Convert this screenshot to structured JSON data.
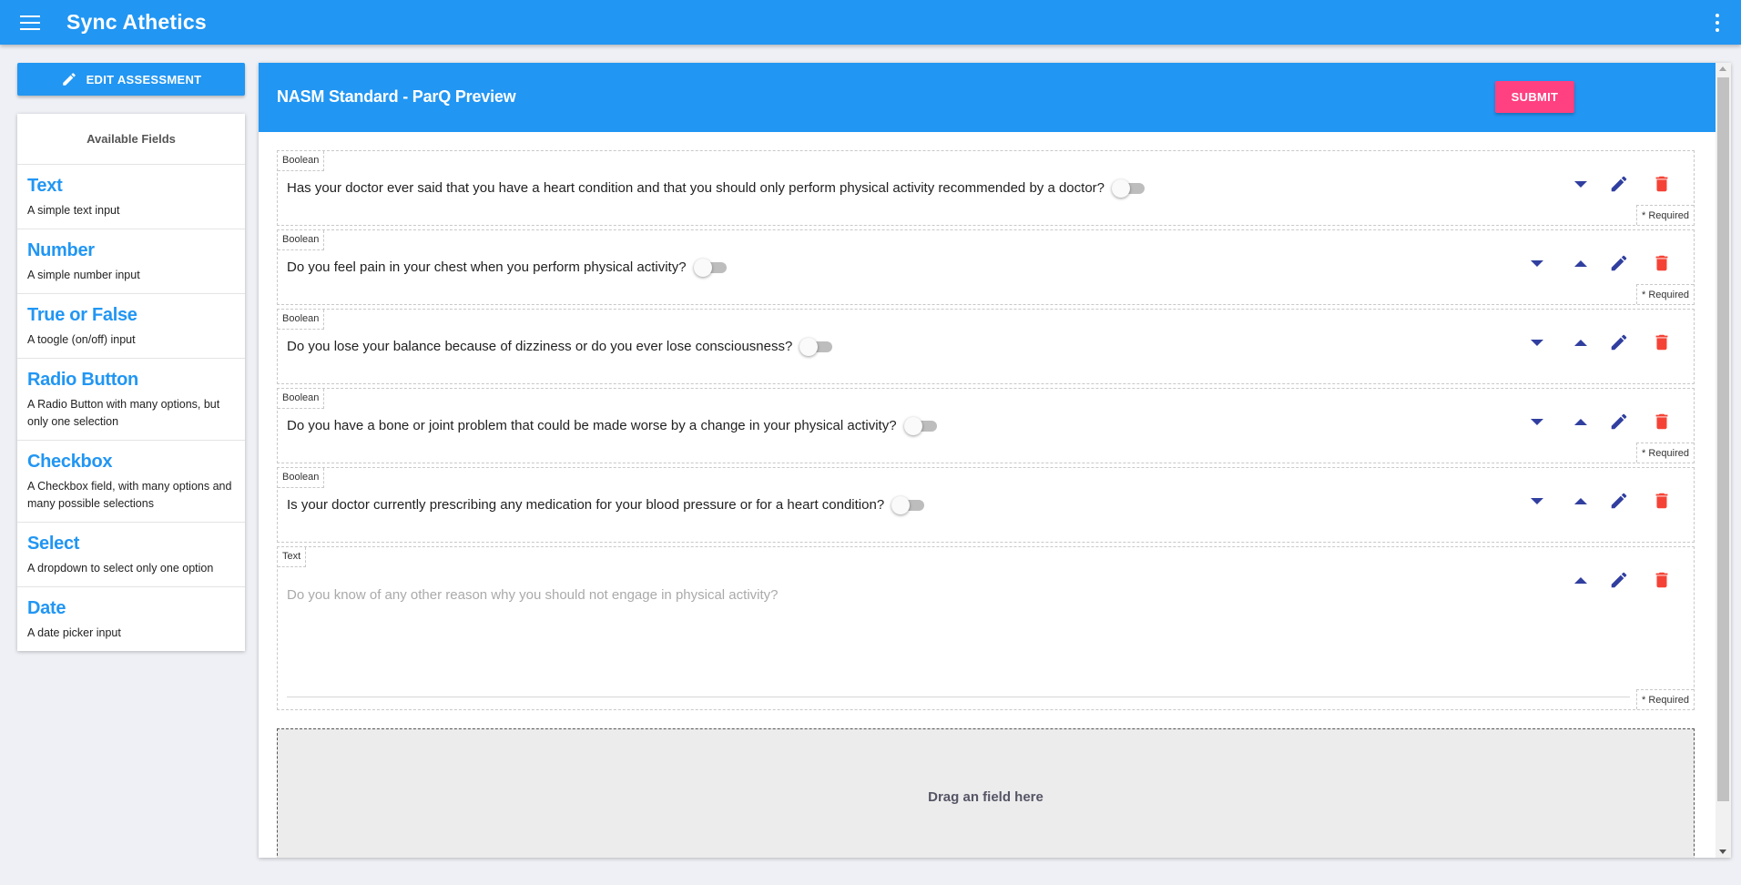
{
  "app": {
    "title": "Sync Athetics"
  },
  "sidebar": {
    "edit_button_label": "EDIT ASSESSMENT",
    "available_fields_title": "Available Fields",
    "field_types": [
      {
        "name": "Text",
        "description": "A simple text input"
      },
      {
        "name": "Number",
        "description": "A simple number input"
      },
      {
        "name": "True or False",
        "description": "A toogle (on/off) input"
      },
      {
        "name": "Radio Button",
        "description": "A Radio Button with many options, but only one selection"
      },
      {
        "name": "Checkbox",
        "description": "A Checkbox field, with many options and many possible selections"
      },
      {
        "name": "Select",
        "description": "A dropdown to select only one option"
      },
      {
        "name": "Date",
        "description": "A date picker input"
      }
    ]
  },
  "preview": {
    "title": "NASM Standard - ParQ Preview",
    "submit_label": "SUBMIT",
    "required_label": "* Required",
    "fields": [
      {
        "type": "Boolean",
        "question": "Has your doctor ever said that you have a heart condition and that you should only perform physical activity recommended by a doctor?",
        "required": true,
        "value": false
      },
      {
        "type": "Boolean",
        "question": "Do you feel pain in your chest when you perform physical activity?",
        "required": true,
        "value": false
      },
      {
        "type": "Boolean",
        "question": "Do you lose your balance because of dizziness or do you ever lose consciousness?",
        "required": false,
        "value": false
      },
      {
        "type": "Boolean",
        "question": "Do you have a bone or joint problem that could be made worse by a change in your physical activity?",
        "required": true,
        "value": false
      },
      {
        "type": "Boolean",
        "question": "Is your doctor currently prescribing any medication for your blood pressure or for a heart condition?",
        "required": false,
        "value": false
      },
      {
        "type": "Text",
        "placeholder": "Do you know of any other reason why you should not engage in physical activity?",
        "required": true,
        "value": ""
      }
    ],
    "dropzone_label": "Drag an field here"
  },
  "colors": {
    "primary": "#2196f3",
    "accent": "#ff4081",
    "action_icon": "#303f9f",
    "delete_icon": "#f44336"
  },
  "icons": {
    "menu": "menu-icon",
    "more": "more-vert-icon",
    "edit": "pencil-icon",
    "delete": "trash-icon",
    "move_down": "arrow-down-icon",
    "move_up": "arrow-up-icon"
  }
}
